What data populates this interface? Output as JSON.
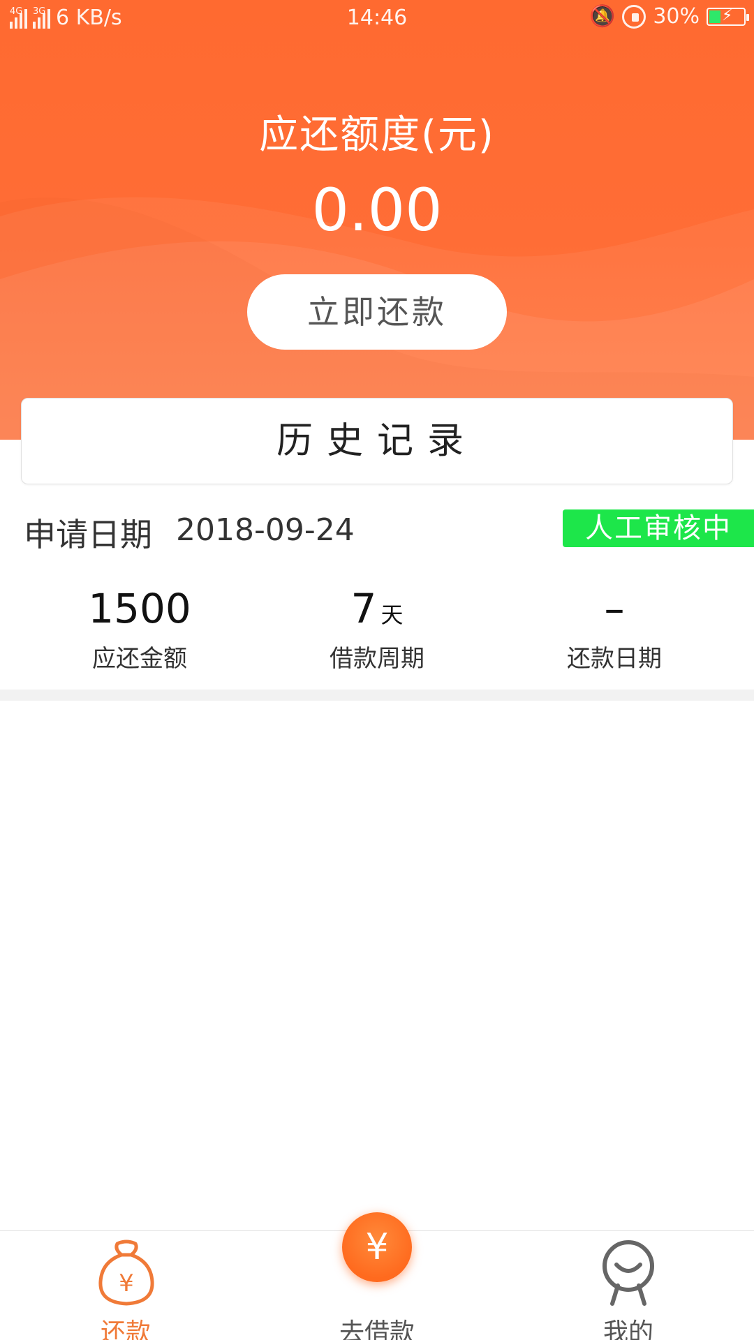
{
  "status_bar": {
    "network_1": "4G",
    "network_2": "3G",
    "speed": "6 KB/s",
    "time": "14:46",
    "battery": "30%"
  },
  "header": {
    "title": "应还额度(元)",
    "amount": "0.00",
    "repay_button": "立即还款"
  },
  "history": {
    "title": "历史记录"
  },
  "record": {
    "apply_label": "申请日期",
    "apply_date": "2018-09-24",
    "status": "人工审核中",
    "stats": [
      {
        "value": "1500",
        "unit": "",
        "label": "应还金额"
      },
      {
        "value": "7",
        "unit": "天",
        "label": "借款周期"
      },
      {
        "value": "–",
        "unit": "",
        "label": "还款日期"
      }
    ]
  },
  "bottom_nav": {
    "items": [
      {
        "label": "还款",
        "icon": "money-bag-icon",
        "active": true
      },
      {
        "label": "去借款",
        "icon": "yen-coin-icon",
        "active": false
      },
      {
        "label": "我的",
        "icon": "person-icon",
        "active": false
      }
    ],
    "center_symbol": "¥"
  },
  "colors": {
    "brand_orange": "#ff6a30",
    "active_nav": "#f07a38",
    "status_green": "#1de64a"
  }
}
